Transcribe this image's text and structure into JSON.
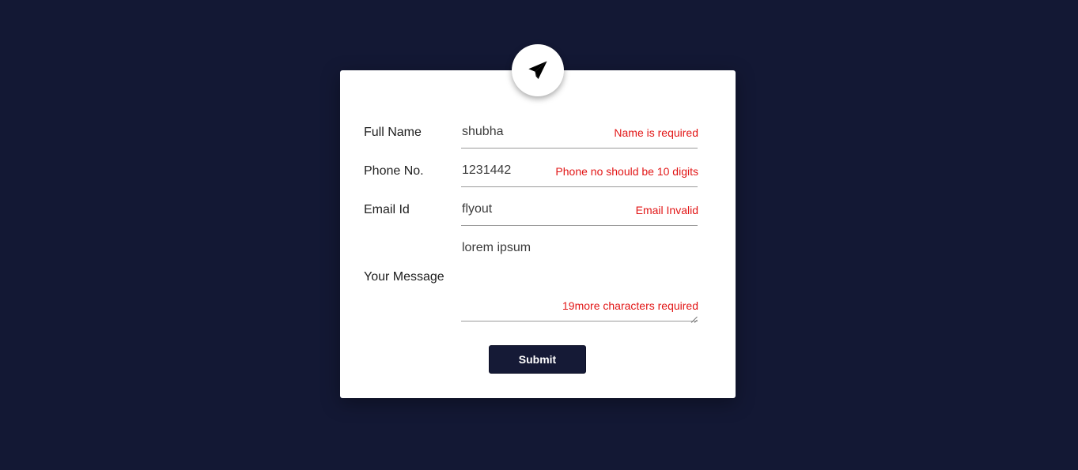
{
  "header": {
    "icon": "paper-plane-icon"
  },
  "form": {
    "full_name": {
      "label": "Full Name",
      "value": "shubha",
      "error": "Name is required"
    },
    "phone": {
      "label": "Phone No.",
      "value": "1231442",
      "error": "Phone no should be 10 digits"
    },
    "email": {
      "label": "Email Id",
      "value": "flyout",
      "error": "Email Invalid"
    },
    "message": {
      "label": "Your Message",
      "value": "lorem ipsum",
      "error": "19more characters required"
    },
    "submit_label": "Submit"
  },
  "colors": {
    "background": "#131834",
    "card": "#ffffff",
    "error": "#e21616",
    "button": "#151a36"
  }
}
